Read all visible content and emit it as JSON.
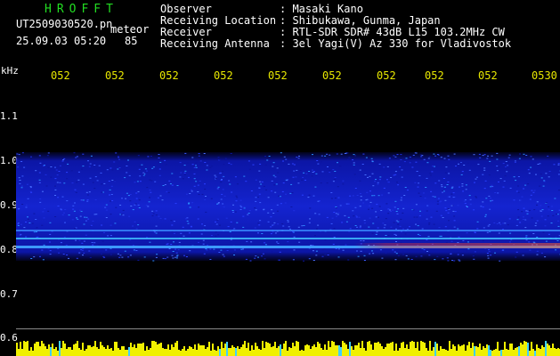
{
  "header": {
    "app_title": "HROFFT",
    "file_name": "UT2509030520.pn",
    "meteor_label": "meteor",
    "datetime": "25.09.03 05:20",
    "count": "85"
  },
  "info": [
    {
      "label": "Observer",
      "value": ": Masaki Kano"
    },
    {
      "label": "Receiving Location",
      "value": ": Shibukawa, Gunma, Japan"
    },
    {
      "label": "Receiver",
      "value": ": RTL-SDR SDR# 43dB L15 103.2MHz CW"
    },
    {
      "label": "Receiving Antenna",
      "value": ": 3el Yagi(V) Az 330 for Vladivostok"
    }
  ],
  "axis": {
    "unit": "kHz",
    "y_ticks": [
      "1.1",
      "1.0",
      "0.9",
      "0.8",
      "0.7",
      "0.6"
    ],
    "time_ticks": [
      "052",
      "052",
      "052",
      "052",
      "052",
      "052",
      "052",
      "052",
      "052",
      "0530"
    ]
  },
  "colors": {
    "background": "#000000",
    "header_text": "#ffffff",
    "title_green": "#22dd22",
    "time_axis_yellow": "#e8e800",
    "noise_band_blue": "#1a2fd8",
    "signal_line_cyan": "#40a0ff",
    "signal_hot_red": "#ff3020",
    "activity_bar_yellow": "#f0f000"
  }
}
